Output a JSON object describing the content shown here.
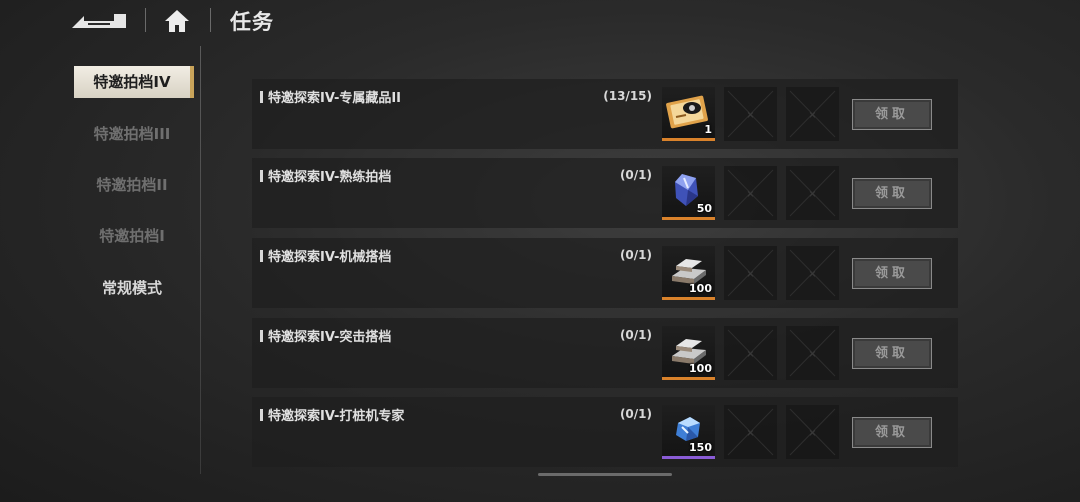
{
  "header": {
    "title": "任务"
  },
  "sidebar": {
    "items": [
      {
        "label": "特邀拍档IV",
        "state": "active"
      },
      {
        "label": "特邀拍档III",
        "state": "dim"
      },
      {
        "label": "特邀拍档II",
        "state": "dim"
      },
      {
        "label": "特邀拍档I",
        "state": "dim"
      },
      {
        "label": "常规模式",
        "state": "plain"
      }
    ]
  },
  "tasks": [
    {
      "name": "特邀探索IV-专属藏品II",
      "progress": "(13/15)",
      "reward_icon": "ticket-card-icon",
      "reward_count": "1",
      "rarity_color": "#d9822b",
      "claim_label": "领取"
    },
    {
      "name": "特邀探索IV-熟练拍档",
      "progress": "(0/1)",
      "reward_icon": "blue-crystal-icon",
      "reward_count": "50",
      "rarity_color": "#d9822b",
      "claim_label": "领取"
    },
    {
      "name": "特邀探索IV-机械搭档",
      "progress": "(0/1)",
      "reward_icon": "metal-ingot-icon",
      "reward_count": "100",
      "rarity_color": "#d9822b",
      "claim_label": "领取"
    },
    {
      "name": "特邀探索IV-突击搭档",
      "progress": "(0/1)",
      "reward_icon": "metal-ingot-icon",
      "reward_count": "100",
      "rarity_color": "#d9822b",
      "claim_label": "领取"
    },
    {
      "name": "特邀探索IV-打桩机专家",
      "progress": "(0/1)",
      "reward_icon": "blue-gem-icon",
      "reward_count": "150",
      "rarity_color": "#8a5cd6",
      "claim_label": "领取"
    }
  ]
}
